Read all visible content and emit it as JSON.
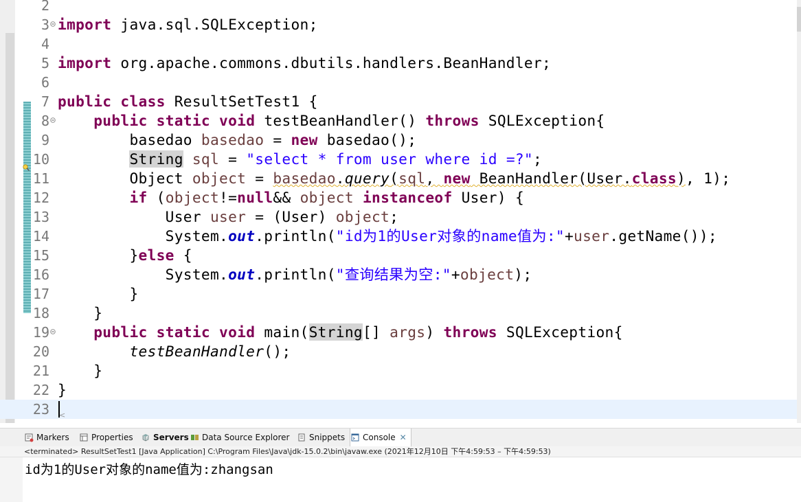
{
  "editor": {
    "lines": [
      {
        "n": "2",
        "code": []
      },
      {
        "n": "3",
        "fold": true,
        "code": [
          {
            "t": "import",
            "c": "kw"
          },
          {
            "t": " java.sql.SQLException;"
          }
        ]
      },
      {
        "n": "4",
        "code": []
      },
      {
        "n": "5",
        "code": [
          {
            "t": "import",
            "c": "kw"
          },
          {
            "t": " org.apache.commons.dbutils.handlers.BeanHandler;"
          }
        ]
      },
      {
        "n": "6",
        "code": []
      },
      {
        "n": "7",
        "code": [
          {
            "t": "public",
            "c": "kw"
          },
          {
            "t": " "
          },
          {
            "t": "class",
            "c": "kw"
          },
          {
            "t": " ResultSetTest1 {"
          }
        ]
      },
      {
        "n": "8",
        "fold": true,
        "code": [
          {
            "t": "    "
          },
          {
            "t": "public",
            "c": "kw"
          },
          {
            "t": " "
          },
          {
            "t": "static",
            "c": "kw"
          },
          {
            "t": " "
          },
          {
            "t": "void",
            "c": "kw"
          },
          {
            "t": " testBeanHandler() "
          },
          {
            "t": "throws",
            "c": "kw"
          },
          {
            "t": " SQLException{"
          }
        ]
      },
      {
        "n": "9",
        "code": [
          {
            "t": "        basedao "
          },
          {
            "t": "basedao",
            "c": "var"
          },
          {
            "t": " = "
          },
          {
            "t": "new",
            "c": "kw"
          },
          {
            "t": " basedao();"
          }
        ]
      },
      {
        "n": "10",
        "code": [
          {
            "t": "        "
          },
          {
            "t": "String",
            "c": "hl"
          },
          {
            "t": " "
          },
          {
            "t": "sql",
            "c": "var"
          },
          {
            "t": " = "
          },
          {
            "t": "\"select * from user where id =?\"",
            "c": "str"
          },
          {
            "t": ";"
          }
        ]
      },
      {
        "n": "11",
        "code": [
          {
            "t": "        Object "
          },
          {
            "t": "object",
            "c": "var"
          },
          {
            "t": " = "
          },
          {
            "t": "basedao",
            "c": "var ul"
          },
          {
            "t": ".",
            "c": "ul"
          },
          {
            "t": "query",
            "c": "mth ul"
          },
          {
            "t": "(",
            "c": "ul"
          },
          {
            "t": "sql",
            "c": "var ul"
          },
          {
            "t": ", ",
            "c": "ul"
          },
          {
            "t": "new",
            "c": "kw ul"
          },
          {
            "t": " BeanHandler(User.",
            "c": "ul"
          },
          {
            "t": "class",
            "c": "kw ul"
          },
          {
            "t": ")",
            "c": "ul"
          },
          {
            "t": ", 1);"
          }
        ]
      },
      {
        "n": "12",
        "code": [
          {
            "t": "        "
          },
          {
            "t": "if",
            "c": "kw"
          },
          {
            "t": " ("
          },
          {
            "t": "object",
            "c": "var"
          },
          {
            "t": "!="
          },
          {
            "t": "null",
            "c": "kw"
          },
          {
            "t": "&& "
          },
          {
            "t": "object",
            "c": "var"
          },
          {
            "t": " "
          },
          {
            "t": "instanceof",
            "c": "kw"
          },
          {
            "t": " User) {"
          }
        ]
      },
      {
        "n": "13",
        "code": [
          {
            "t": "            User "
          },
          {
            "t": "user",
            "c": "var"
          },
          {
            "t": " = (User) "
          },
          {
            "t": "object",
            "c": "var"
          },
          {
            "t": ";"
          }
        ]
      },
      {
        "n": "14",
        "code": [
          {
            "t": "            System."
          },
          {
            "t": "out",
            "c": "fld"
          },
          {
            "t": ".println("
          },
          {
            "t": "\"id为1的User对象的name值为:\"",
            "c": "str"
          },
          {
            "t": "+"
          },
          {
            "t": "user",
            "c": "var"
          },
          {
            "t": ".getName());"
          }
        ]
      },
      {
        "n": "15",
        "code": [
          {
            "t": "        }"
          },
          {
            "t": "else",
            "c": "kw"
          },
          {
            "t": " {"
          }
        ]
      },
      {
        "n": "16",
        "code": [
          {
            "t": "            System."
          },
          {
            "t": "out",
            "c": "fld"
          },
          {
            "t": ".println("
          },
          {
            "t": "\"查询结果为空:\"",
            "c": "str"
          },
          {
            "t": "+"
          },
          {
            "t": "object",
            "c": "var"
          },
          {
            "t": ");"
          }
        ]
      },
      {
        "n": "17",
        "code": [
          {
            "t": "        }"
          }
        ]
      },
      {
        "n": "18",
        "code": [
          {
            "t": "    }"
          }
        ]
      },
      {
        "n": "19",
        "fold": true,
        "code": [
          {
            "t": "    "
          },
          {
            "t": "public",
            "c": "kw"
          },
          {
            "t": " "
          },
          {
            "t": "static",
            "c": "kw"
          },
          {
            "t": " "
          },
          {
            "t": "void",
            "c": "kw"
          },
          {
            "t": " main("
          },
          {
            "t": "String",
            "c": "hl"
          },
          {
            "t": "[] "
          },
          {
            "t": "args",
            "c": "var"
          },
          {
            "t": ") "
          },
          {
            "t": "throws",
            "c": "kw"
          },
          {
            "t": " SQLException{"
          }
        ]
      },
      {
        "n": "20",
        "code": [
          {
            "t": "        "
          },
          {
            "t": "testBeanHandler",
            "c": "mth"
          },
          {
            "t": "();"
          }
        ]
      },
      {
        "n": "21",
        "code": [
          {
            "t": "    }"
          }
        ]
      },
      {
        "n": "22",
        "code": [
          {
            "t": "}"
          }
        ]
      },
      {
        "n": "23",
        "current": true,
        "code": []
      }
    ]
  },
  "views": {
    "tabs": [
      {
        "label": "Markers",
        "icon": "markers-icon"
      },
      {
        "label": "Properties",
        "icon": "properties-icon"
      },
      {
        "label": "Servers",
        "icon": "servers-icon",
        "bold": true
      },
      {
        "label": "Data Source Explorer",
        "icon": "data-source-icon"
      },
      {
        "label": "Snippets",
        "icon": "snippets-icon"
      },
      {
        "label": "Console",
        "icon": "console-icon",
        "active": true,
        "closable": "✕"
      }
    ],
    "status": "<terminated> ResultSetTest1 [Java Application] C:\\Program Files\\Java\\jdk-15.0.2\\bin\\javaw.exe  (2021年12月10日 下午4:59:53 – 下午4:59:53)",
    "console_output": "id为1的User对象的name值为:zhangsan"
  }
}
